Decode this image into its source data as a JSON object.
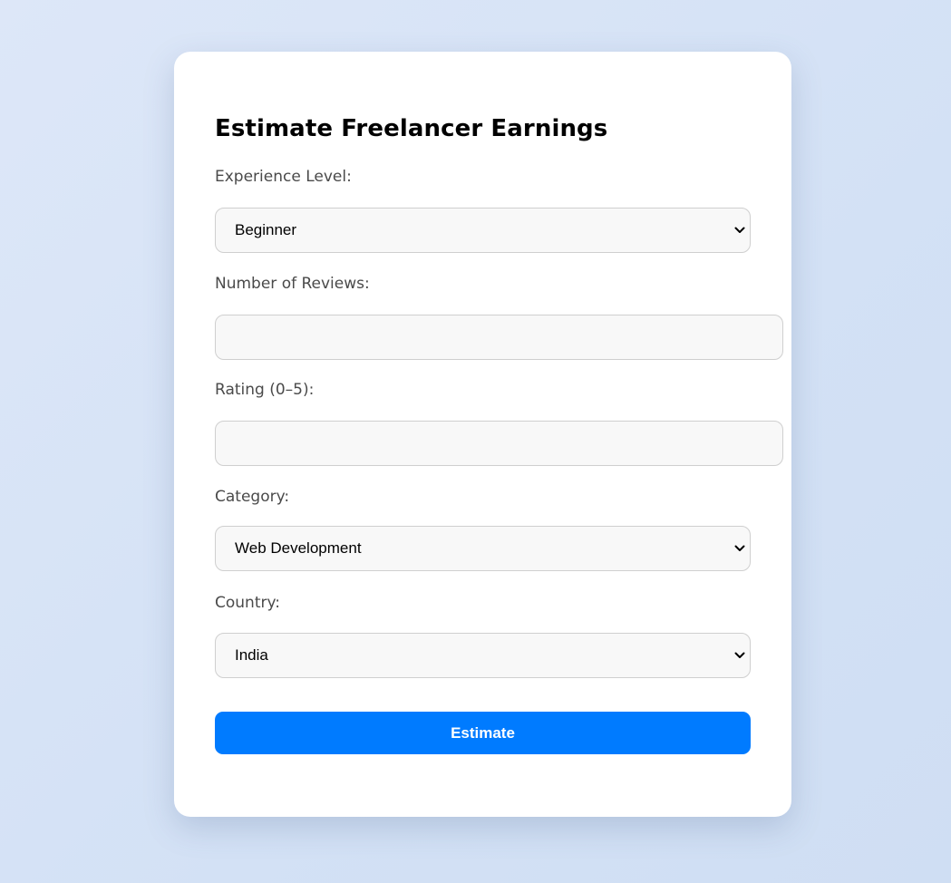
{
  "form": {
    "title": "Estimate Freelancer Earnings",
    "experience": {
      "label": "Experience Level:",
      "selected": "Beginner"
    },
    "reviews": {
      "label": "Number of Reviews:",
      "value": "",
      "placeholder": ""
    },
    "rating": {
      "label": "Rating (0–5):",
      "value": "",
      "placeholder": ""
    },
    "category": {
      "label": "Category:",
      "selected": "Web Development"
    },
    "country": {
      "label": "Country:",
      "selected": "India"
    },
    "submit_label": "Estimate"
  },
  "colors": {
    "accent": "#007bff",
    "card": "#ffffff",
    "field_bg": "#f8f8f8",
    "field_border": "#cfcfcf",
    "label_text": "#4a4a4a"
  },
  "icons": {
    "select_arrow": "chevron-down-icon"
  }
}
